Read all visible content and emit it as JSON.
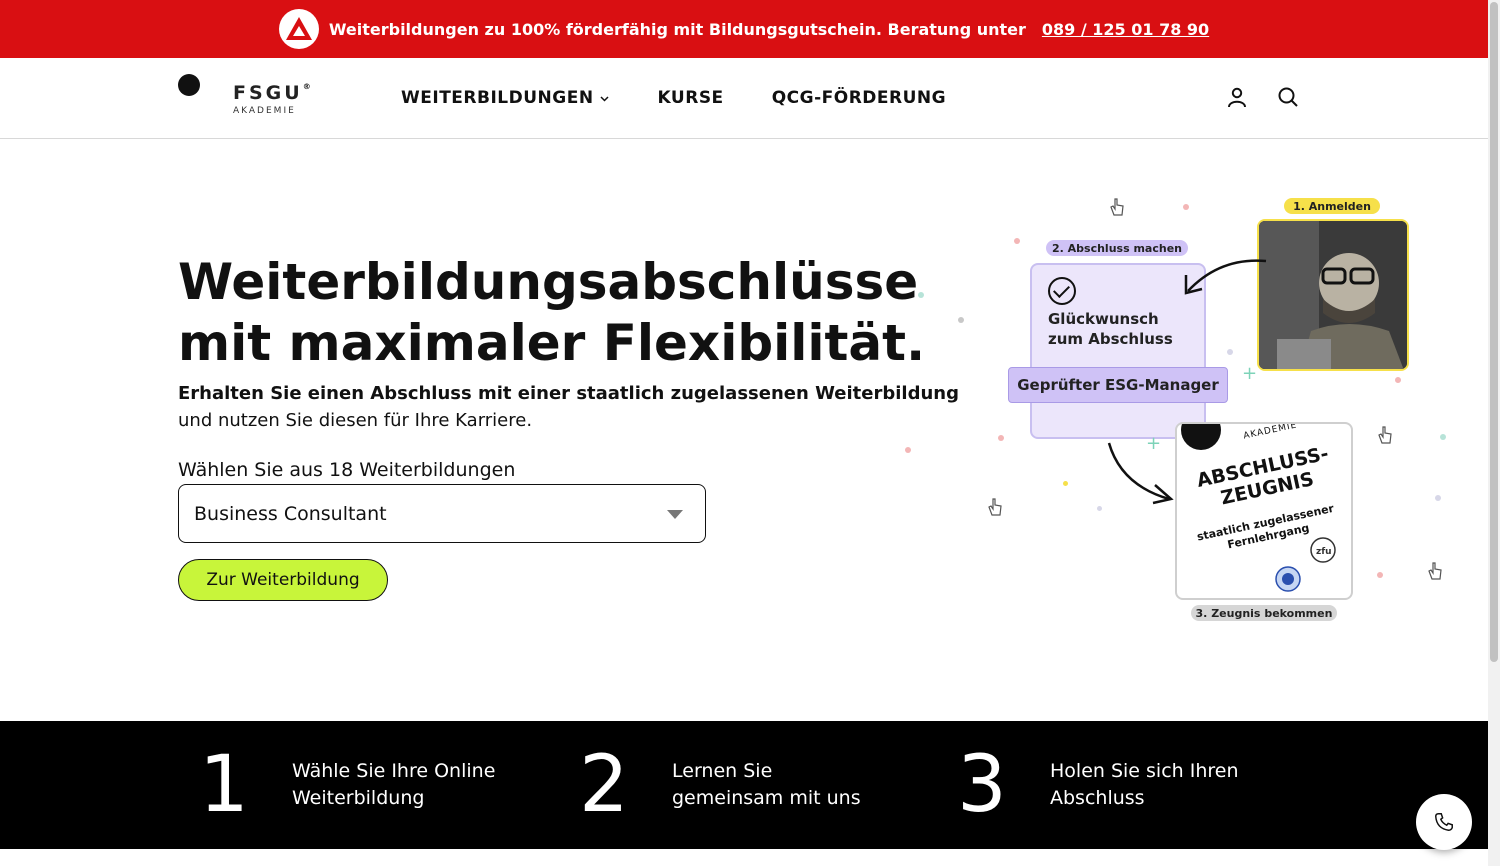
{
  "topbar": {
    "text": "Weiterbildungen zu 100% förderfähig mit Bildungsgutschein. Beratung unter",
    "phone": "089 / 125 01 78 90"
  },
  "header": {
    "brand": "FSGU",
    "brand_mark": "®",
    "brand_sub": "AKADEMIE",
    "nav": [
      {
        "label": "WEITERBILDUNGEN"
      },
      {
        "label": "KURSE"
      },
      {
        "label": "QCG-FÖRDERUNG"
      }
    ]
  },
  "hero": {
    "title_line1": "Weiterbildungsabschlüsse",
    "title_line2": "mit maximaler Flexibilität.",
    "subtitle_strong": "Erhalten Sie einen Abschluss mit einer staatlich zugelassenen Weiterbildung",
    "subtitle_rest": "und nutzen Sie diesen für Ihre Karriere.",
    "select_label": "Wählen Sie aus 18 Weiterbildungen",
    "select_value": "Business Consultant",
    "cta_label": "Zur Weiterbildung"
  },
  "illustration": {
    "tag1": "1. Anmelden",
    "tag2": "2. Abschluss machen",
    "tag3": "3. Zeugnis bekommen",
    "card_text": "Glückwunsch zum Abschluss",
    "card_line1": "Glückwunsch",
    "card_line2": "zum Abschluss",
    "pill": "Geprüfter ESG-Manager",
    "cert_akademie": "AKADEMIE",
    "cert_title1": "ABSCHLUSS-",
    "cert_title2": "ZEUGNIS",
    "cert_small1": "staatlich zugelassener",
    "cert_small2": "Fernlehrgang",
    "cert_logo": "zfu"
  },
  "steps": [
    {
      "num": "1",
      "line1": "Wähle Sie Ihre Online",
      "line2": "Weiterbildung"
    },
    {
      "num": "2",
      "line1": "Lernen Sie",
      "line2": "gemeinsam mit uns"
    },
    {
      "num": "3",
      "line1": "Holen Sie sich Ihren",
      "line2": "Abschluss"
    }
  ],
  "colors": {
    "banner_red": "#d90f12",
    "lime": "#c8f53a",
    "steps_bg": "#000000"
  },
  "icons": {
    "banner": "bildungsgutschein-triangle-icon",
    "account": "user-icon",
    "search": "search-icon",
    "dropdown": "chevron-down-icon",
    "call": "phone-icon"
  }
}
